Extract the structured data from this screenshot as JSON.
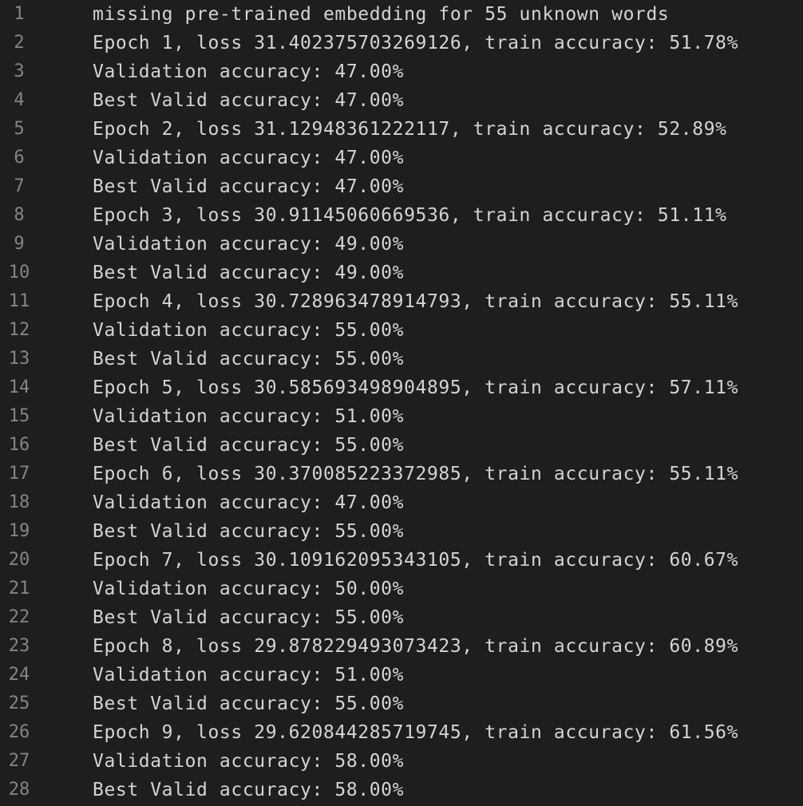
{
  "editor": {
    "lines": [
      {
        "n": "1",
        "text": "missing pre-trained embedding for 55 unknown words"
      },
      {
        "n": "2",
        "text": "Epoch 1, loss 31.402375703269126, train accuracy: 51.78%"
      },
      {
        "n": "3",
        "text": "Validation accuracy: 47.00%"
      },
      {
        "n": "4",
        "text": "Best Valid accuracy: 47.00%"
      },
      {
        "n": "5",
        "text": "Epoch 2, loss 31.12948361222117, train accuracy: 52.89%"
      },
      {
        "n": "6",
        "text": "Validation accuracy: 47.00%"
      },
      {
        "n": "7",
        "text": "Best Valid accuracy: 47.00%"
      },
      {
        "n": "8",
        "text": "Epoch 3, loss 30.91145060669536, train accuracy: 51.11%"
      },
      {
        "n": "9",
        "text": "Validation accuracy: 49.00%"
      },
      {
        "n": "10",
        "text": "Best Valid accuracy: 49.00%"
      },
      {
        "n": "11",
        "text": "Epoch 4, loss 30.728963478914793, train accuracy: 55.11%"
      },
      {
        "n": "12",
        "text": "Validation accuracy: 55.00%"
      },
      {
        "n": "13",
        "text": "Best Valid accuracy: 55.00%"
      },
      {
        "n": "14",
        "text": "Epoch 5, loss 30.585693498904895, train accuracy: 57.11%"
      },
      {
        "n": "15",
        "text": "Validation accuracy: 51.00%"
      },
      {
        "n": "16",
        "text": "Best Valid accuracy: 55.00%"
      },
      {
        "n": "17",
        "text": "Epoch 6, loss 30.370085223372985, train accuracy: 55.11%"
      },
      {
        "n": "18",
        "text": "Validation accuracy: 47.00%"
      },
      {
        "n": "19",
        "text": "Best Valid accuracy: 55.00%"
      },
      {
        "n": "20",
        "text": "Epoch 7, loss 30.109162095343105, train accuracy: 60.67%"
      },
      {
        "n": "21",
        "text": "Validation accuracy: 50.00%"
      },
      {
        "n": "22",
        "text": "Best Valid accuracy: 55.00%"
      },
      {
        "n": "23",
        "text": "Epoch 8, loss 29.878229493073423, train accuracy: 60.89%"
      },
      {
        "n": "24",
        "text": "Validation accuracy: 51.00%"
      },
      {
        "n": "25",
        "text": "Best Valid accuracy: 55.00%"
      },
      {
        "n": "26",
        "text": "Epoch 9, loss 29.620844285719745, train accuracy: 61.56%"
      },
      {
        "n": "27",
        "text": "Validation accuracy: 58.00%"
      },
      {
        "n": "28",
        "text": "Best Valid accuracy: 58.00%"
      }
    ]
  }
}
